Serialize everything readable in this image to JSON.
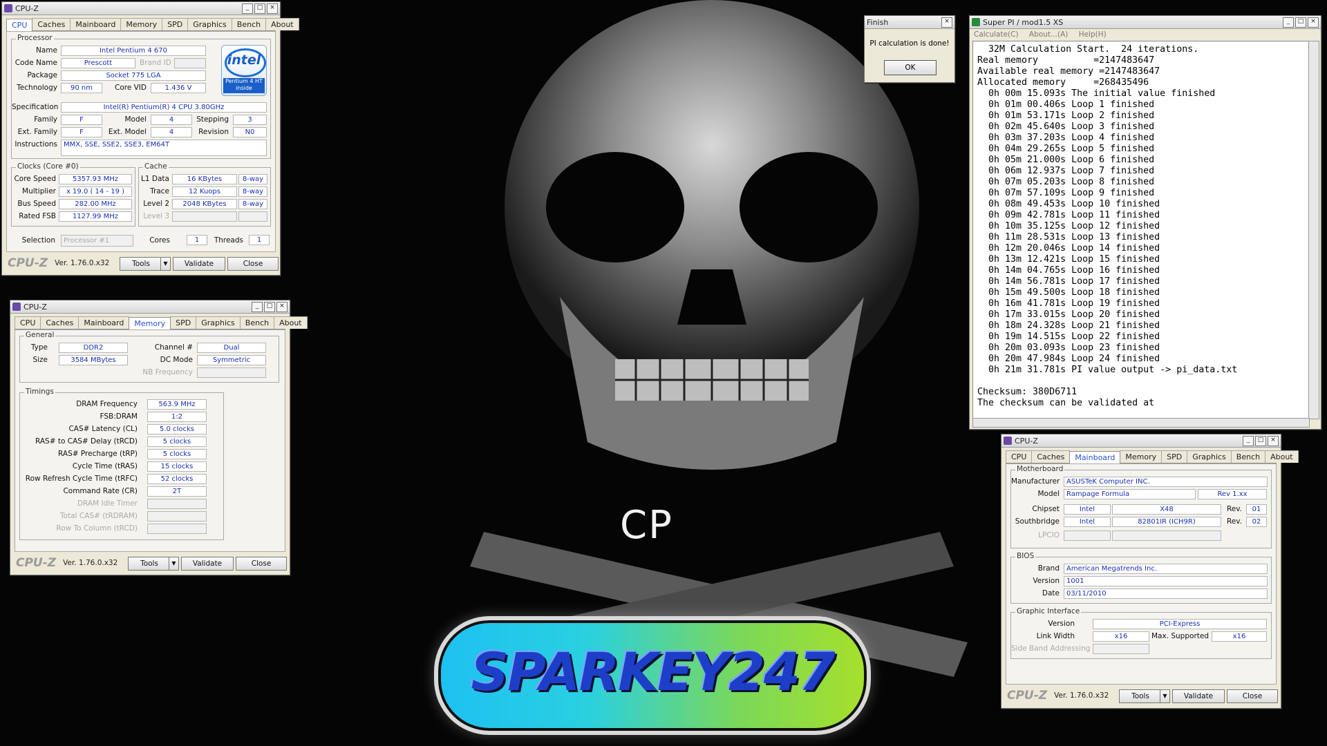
{
  "desktop": {
    "wallpaper_text": "CP",
    "banner_text": "SPARKEY247"
  },
  "colors": {
    "value_text": "#1a2fb0",
    "active_tab": "#2a50c8",
    "banner_start": "#1ec0f0",
    "banner_end": "#a7e02a"
  },
  "cpuz_cpu": {
    "title": "CPU-Z",
    "tabs": [
      "CPU",
      "Caches",
      "Mainboard",
      "Memory",
      "SPD",
      "Graphics",
      "Bench",
      "About"
    ],
    "active_tab": "CPU",
    "processor_group": "Processor",
    "name_label": "Name",
    "name": "Intel Pentium 4 670",
    "code_name_label": "Code Name",
    "code_name": "Prescott",
    "brand_id_label": "Brand ID",
    "package_label": "Package",
    "package": "Socket 775 LGA",
    "technology_label": "Technology",
    "technology": "90 nm",
    "core_vid_label": "Core VID",
    "core_vid": "1.436 V",
    "spec_label": "Specification",
    "spec": "Intel(R) Pentium(R) 4 CPU 3.80GHz",
    "family_label": "Family",
    "family": "F",
    "model_label": "Model",
    "model": "4",
    "stepping_label": "Stepping",
    "stepping": "3",
    "ext_family_label": "Ext. Family",
    "ext_family": "F",
    "ext_model_label": "Ext. Model",
    "ext_model": "4",
    "revision_label": "Revision",
    "revision": "N0",
    "instructions_label": "Instructions",
    "instructions": "MMX, SSE, SSE2, SSE3, EM64T",
    "clocks_group": "Clocks (Core #0)",
    "core_speed_label": "Core Speed",
    "core_speed": "5357.93 MHz",
    "multiplier_label": "Multiplier",
    "multiplier": "x 19.0 ( 14 - 19 )",
    "bus_speed_label": "Bus Speed",
    "bus_speed": "282.00 MHz",
    "rated_fsb_label": "Rated FSB",
    "rated_fsb": "1127.99 MHz",
    "cache_group": "Cache",
    "l1_label": "L1 Data",
    "l1": "16 KBytes",
    "l1_way": "8-way",
    "trace_label": "Trace",
    "trace": "12 Kuops",
    "trace_way": "8-way",
    "l2_label": "Level 2",
    "l2": "2048 KBytes",
    "l2_way": "8-way",
    "l3_label": "Level 3",
    "selection_label": "Selection",
    "selection": "Processor #1",
    "cores_label": "Cores",
    "cores": "1",
    "threads_label": "Threads",
    "threads": "1",
    "intel_logo": "intel",
    "intel_sub": "Pentium 4 HT inside",
    "footer": {
      "brand": "CPU-Z",
      "version": "Ver. 1.76.0.x32",
      "tools": "Tools",
      "validate": "Validate",
      "close": "Close"
    }
  },
  "cpuz_memory": {
    "title": "CPU-Z",
    "tabs": [
      "CPU",
      "Caches",
      "Mainboard",
      "Memory",
      "SPD",
      "Graphics",
      "Bench",
      "About"
    ],
    "active_tab": "Memory",
    "general_group": "General",
    "type_label": "Type",
    "type": "DDR2",
    "size_label": "Size",
    "size": "3584 MBytes",
    "channel_label": "Channel #",
    "channel": "Dual",
    "dc_mode_label": "DC Mode",
    "dc_mode": "Symmetric",
    "nb_freq_label": "NB Frequency",
    "timings_group": "Timings",
    "timings": [
      {
        "label": "DRAM Frequency",
        "value": "563.9 MHz"
      },
      {
        "label": "FSB:DRAM",
        "value": "1:2"
      },
      {
        "label": "CAS# Latency (CL)",
        "value": "5.0 clocks"
      },
      {
        "label": "RAS# to CAS# Delay (tRCD)",
        "value": "5 clocks"
      },
      {
        "label": "RAS# Precharge (tRP)",
        "value": "5 clocks"
      },
      {
        "label": "Cycle Time (tRAS)",
        "value": "15 clocks"
      },
      {
        "label": "Row Refresh Cycle Time (tRFC)",
        "value": "52 clocks"
      },
      {
        "label": "Command Rate (CR)",
        "value": "2T"
      },
      {
        "label": "DRAM Idle Timer",
        "value": ""
      },
      {
        "label": "Total CAS# (tRDRAM)",
        "value": ""
      },
      {
        "label": "Row To Column (tRCD)",
        "value": ""
      }
    ],
    "footer": {
      "brand": "CPU-Z",
      "version": "Ver. 1.76.0.x32",
      "tools": "Tools",
      "validate": "Validate",
      "close": "Close"
    }
  },
  "cpuz_mainboard": {
    "title": "CPU-Z",
    "tabs": [
      "CPU",
      "Caches",
      "Mainboard",
      "Memory",
      "SPD",
      "Graphics",
      "Bench",
      "About"
    ],
    "active_tab": "Mainboard",
    "motherboard_group": "Motherboard",
    "manufacturer_label": "Manufacturer",
    "manufacturer": "ASUSTeK Computer INC.",
    "model_label": "Model",
    "model": "Rampage Formula",
    "model_rev": "Rev 1.xx",
    "chipset_label": "Chipset",
    "chipset_vendor": "Intel",
    "chipset": "X48",
    "chipset_rev_label": "Rev.",
    "chipset_rev": "01",
    "southbridge_label": "Southbridge",
    "sb_vendor": "Intel",
    "southbridge": "82801IR (ICH9R)",
    "sb_rev_label": "Rev.",
    "sb_rev": "02",
    "lpcio_label": "LPCIO",
    "bios_group": "BIOS",
    "bios_brand_label": "Brand",
    "bios_brand": "American Megatrends Inc.",
    "bios_version_label": "Version",
    "bios_version": "1001",
    "bios_date_label": "Date",
    "bios_date": "03/11/2010",
    "gi_group": "Graphic Interface",
    "gi_version_label": "Version",
    "gi_version": "PCI-Express",
    "link_width_label": "Link Width",
    "link_width": "x16",
    "max_supported_label": "Max. Supported",
    "max_supported": "x16",
    "side_band_label": "Side Band Addressing",
    "footer": {
      "brand": "CPU-Z",
      "version": "Ver. 1.76.0.x32",
      "tools": "Tools",
      "validate": "Validate",
      "close": "Close"
    }
  },
  "finish_dialog": {
    "title": "Finish",
    "message": "PI calculation is done!",
    "ok": "OK"
  },
  "superpi": {
    "title": "Super PI / mod1.5 XS",
    "menu": [
      "Calculate(C)",
      "About...(A)",
      "Help(H)"
    ],
    "lines": [
      "  32M Calculation Start.  24 iterations.",
      "Real memory          =2147483647",
      "Available real memory =2147483647",
      "Allocated memory     =268435496",
      "  0h 00m 15.093s The initial value finished",
      "  0h 01m 00.406s Loop 1 finished",
      "  0h 01m 53.171s Loop 2 finished",
      "  0h 02m 45.640s Loop 3 finished",
      "  0h 03m 37.203s Loop 4 finished",
      "  0h 04m 29.265s Loop 5 finished",
      "  0h 05m 21.000s Loop 6 finished",
      "  0h 06m 12.937s Loop 7 finished",
      "  0h 07m 05.203s Loop 8 finished",
      "  0h 07m 57.109s Loop 9 finished",
      "  0h 08m 49.453s Loop 10 finished",
      "  0h 09m 42.781s Loop 11 finished",
      "  0h 10m 35.125s Loop 12 finished",
      "  0h 11m 28.531s Loop 13 finished",
      "  0h 12m 20.046s Loop 14 finished",
      "  0h 13m 12.421s Loop 15 finished",
      "  0h 14m 04.765s Loop 16 finished",
      "  0h 14m 56.781s Loop 17 finished",
      "  0h 15m 49.500s Loop 18 finished",
      "  0h 16m 41.781s Loop 19 finished",
      "  0h 17m 33.015s Loop 20 finished",
      "  0h 18m 24.328s Loop 21 finished",
      "  0h 19m 14.515s Loop 22 finished",
      "  0h 20m 03.093s Loop 23 finished",
      "  0h 20m 47.984s Loop 24 finished",
      "  0h 21m 31.781s PI value output -> pi_data.txt",
      "",
      "Checksum: 380D6711",
      "The checksum can be validated at"
    ]
  }
}
